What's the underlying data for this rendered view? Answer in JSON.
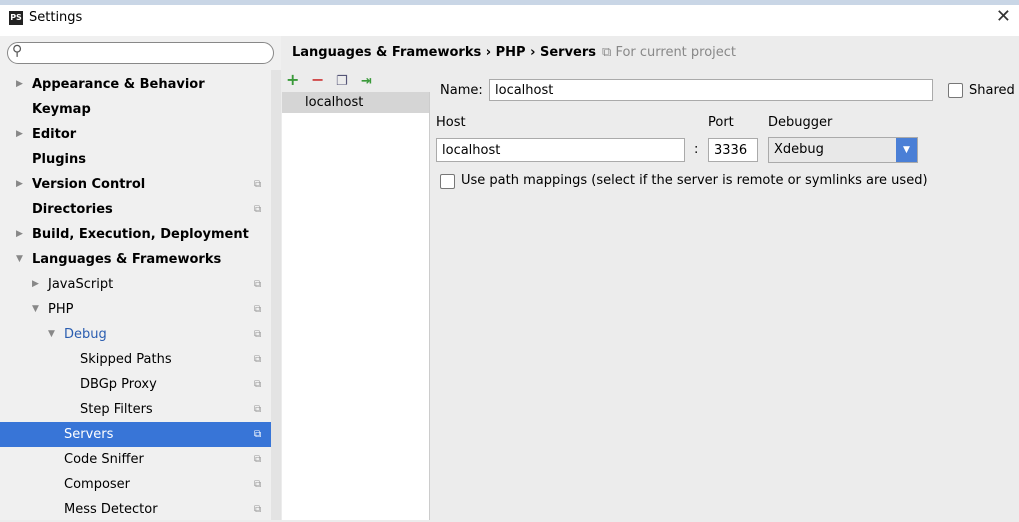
{
  "window": {
    "title": "Settings",
    "logo": "PS"
  },
  "search": {
    "placeholder": ""
  },
  "tree": [
    {
      "label": "Appearance & Behavior",
      "bold": true,
      "arrow": "right",
      "level": 0
    },
    {
      "label": "Keymap",
      "bold": true,
      "level": 0
    },
    {
      "label": "Editor",
      "bold": true,
      "arrow": "right",
      "level": 0
    },
    {
      "label": "Plugins",
      "bold": true,
      "level": 0
    },
    {
      "label": "Version Control",
      "bold": true,
      "arrow": "right",
      "level": 0,
      "copy": true
    },
    {
      "label": "Directories",
      "bold": true,
      "level": 0,
      "copy": true
    },
    {
      "label": "Build, Execution, Deployment",
      "bold": true,
      "arrow": "right",
      "level": 0
    },
    {
      "label": "Languages & Frameworks",
      "bold": true,
      "arrow": "down",
      "level": 0
    },
    {
      "label": "JavaScript",
      "arrow": "right",
      "level": 1,
      "copy": true
    },
    {
      "label": "PHP",
      "arrow": "down",
      "level": 1,
      "copy": true
    },
    {
      "label": "Debug",
      "arrow": "down",
      "level": 2,
      "copy": true,
      "blue": true
    },
    {
      "label": "Skipped Paths",
      "level": 3,
      "copy": true
    },
    {
      "label": "DBGp Proxy",
      "level": 3,
      "copy": true
    },
    {
      "label": "Step Filters",
      "level": 3,
      "copy": true
    },
    {
      "label": "Servers",
      "level": 2,
      "copy": true,
      "selected": true
    },
    {
      "label": "Code Sniffer",
      "level": 2,
      "copy": true
    },
    {
      "label": "Composer",
      "level": 2,
      "copy": true
    },
    {
      "label": "Mess Detector",
      "level": 2,
      "copy": true
    }
  ],
  "breadcrumb": {
    "path": "Languages & Frameworks › PHP › Servers",
    "scope": "For current project"
  },
  "servers": [
    "localhost"
  ],
  "form": {
    "name_label": "Name:",
    "name_value": "localhost",
    "shared_label": "Shared",
    "shared_checked": false,
    "host_label": "Host",
    "host_value": "localhost",
    "colon": ":",
    "port_label": "Port",
    "port_value": "3336",
    "debugger_label": "Debugger",
    "debugger_value": "Xdebug",
    "path_mappings_label": "Use path mappings (select if the server is remote or symlinks are used)",
    "path_mappings_checked": false
  },
  "colors": {
    "selection": "#3875d7",
    "accent": "#4a7fd6"
  }
}
